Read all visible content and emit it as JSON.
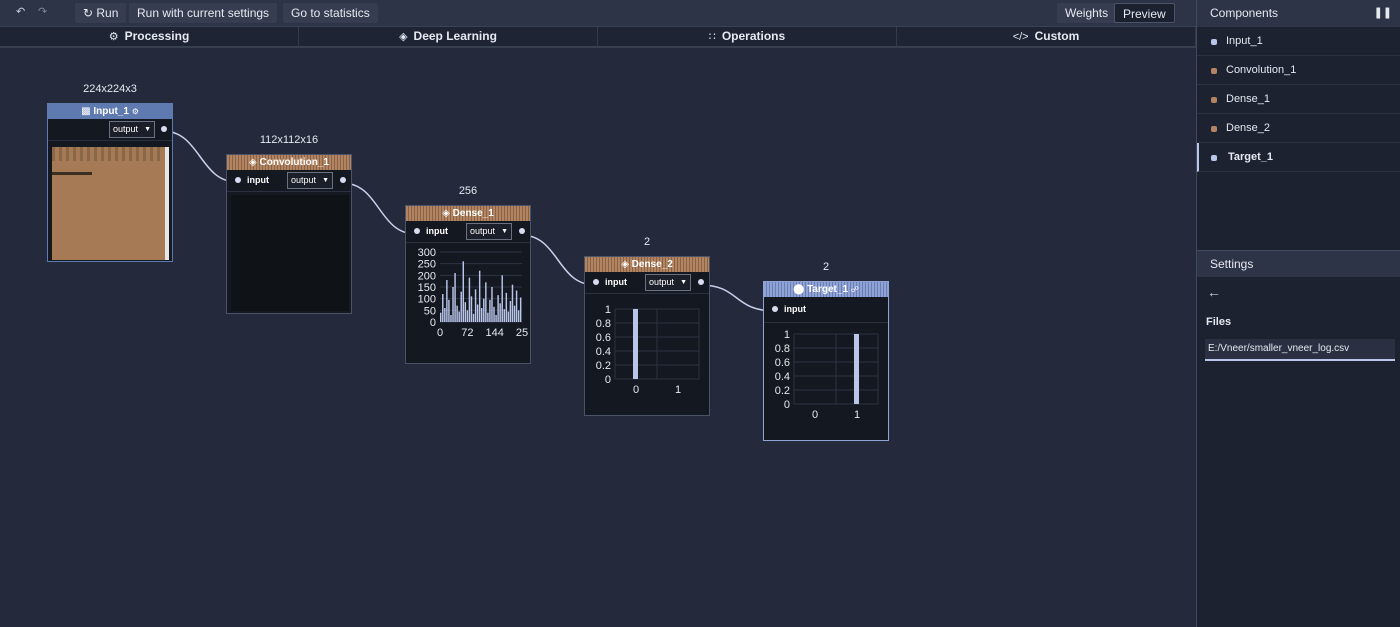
{
  "toolbar": {
    "undo_icon": "undo-icon",
    "redo_icon": "redo-icon",
    "run_label": "Run",
    "run_current_label": "Run with current settings",
    "statistics_label": "Go to statistics",
    "weights_label": "Weights",
    "preview_label": "Preview"
  },
  "tabs": [
    {
      "label": "Processing",
      "icon": "gear-icon"
    },
    {
      "label": "Deep Learning",
      "icon": "layers-icon"
    },
    {
      "label": "Operations",
      "icon": "grid-icon"
    },
    {
      "label": "Custom",
      "icon": "code-icon"
    }
  ],
  "sidebar": {
    "components_title": "Components",
    "components": [
      {
        "label": "Input_1",
        "color": "#b9c6ea"
      },
      {
        "label": "Convolution_1",
        "color": "#b38461"
      },
      {
        "label": "Dense_1",
        "color": "#b38461"
      },
      {
        "label": "Dense_2",
        "color": "#b38461"
      },
      {
        "label": "Target_1",
        "color": "#b9c6ea"
      }
    ],
    "settings_title": "Settings",
    "files_label": "Files",
    "file_path": "E:/Vneer/smaller_vneer_log.csv"
  },
  "nodes": {
    "input": {
      "title": "Input_1",
      "dims": "224x224x3",
      "output": "output"
    },
    "conv": {
      "title": "Convolution_1",
      "dims": "112x112x16",
      "input": "input",
      "output": "output"
    },
    "dense1": {
      "title": "Dense_1",
      "dims": "256",
      "input": "input",
      "output": "output"
    },
    "dense2": {
      "title": "Dense_2",
      "dims": "2",
      "input": "input",
      "output": "output"
    },
    "target": {
      "title": "Target_1",
      "dims": "2",
      "input": "input"
    }
  },
  "chart_data": [
    {
      "type": "bar",
      "chart": "dense1",
      "y_ticks": [
        "300",
        "250",
        "200",
        "150",
        "100",
        "50",
        "0"
      ],
      "x_ticks": [
        "0",
        "72",
        "144",
        "25"
      ],
      "ylim": [
        0,
        300
      ],
      "values": [
        40,
        120,
        60,
        180,
        95,
        30,
        150,
        210,
        70,
        45,
        130,
        260,
        85,
        50,
        190,
        110,
        35,
        140,
        75,
        220,
        60,
        100,
        170,
        40,
        95,
        150,
        65,
        30,
        115,
        80,
        200,
        55,
        125,
        45,
        90,
        160,
        70,
        135,
        50,
        105
      ]
    },
    {
      "type": "bar",
      "chart": "dense2",
      "categories": [
        "0",
        "1"
      ],
      "values": [
        1,
        0
      ],
      "y_ticks": [
        "1",
        "0.8",
        "0.6",
        "0.4",
        "0.2",
        "0"
      ],
      "ylim": [
        0,
        1
      ]
    },
    {
      "type": "bar",
      "chart": "target",
      "categories": [
        "0",
        "1"
      ],
      "values": [
        0,
        1
      ],
      "y_ticks": [
        "1",
        "0.8",
        "0.6",
        "0.4",
        "0.2",
        "0"
      ],
      "ylim": [
        0,
        1
      ]
    }
  ]
}
